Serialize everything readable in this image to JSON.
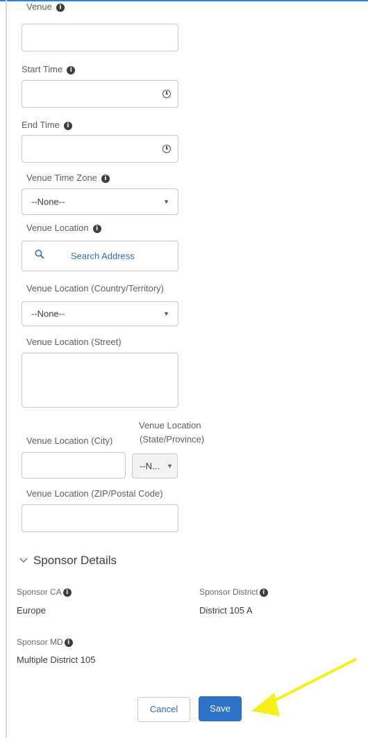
{
  "form": {
    "venue_label": "Venue",
    "start_time_label": "Start Time",
    "end_time_label": "End Time",
    "venue_time_zone_label": "Venue Time Zone",
    "venue_time_zone_value": "--None--",
    "venue_location_label": "Venue Location",
    "search_address_placeholder": "Search Address",
    "country_label": "Venue Location (Country/Territory)",
    "country_value": "--None--",
    "street_label": "Venue Location (Street)",
    "city_label": "Venue Location (City)",
    "state_label_line1": "Venue Location",
    "state_label_line2": "(State/Province)",
    "state_value": "--N...",
    "zip_label": "Venue Location (ZIP/Postal Code)"
  },
  "sponsor": {
    "section_title": "Sponsor Details",
    "ca_label": "Sponsor CA",
    "ca_value": "Europe",
    "district_label": "Sponsor District",
    "district_value": "District 105 A",
    "md_label": "Sponsor MD",
    "md_value": "Multiple District 105"
  },
  "actions": {
    "cancel_label": "Cancel",
    "save_label": "Save"
  },
  "colors": {
    "accent": "#2f73c9",
    "annotation_arrow": "#f5ef1a"
  }
}
